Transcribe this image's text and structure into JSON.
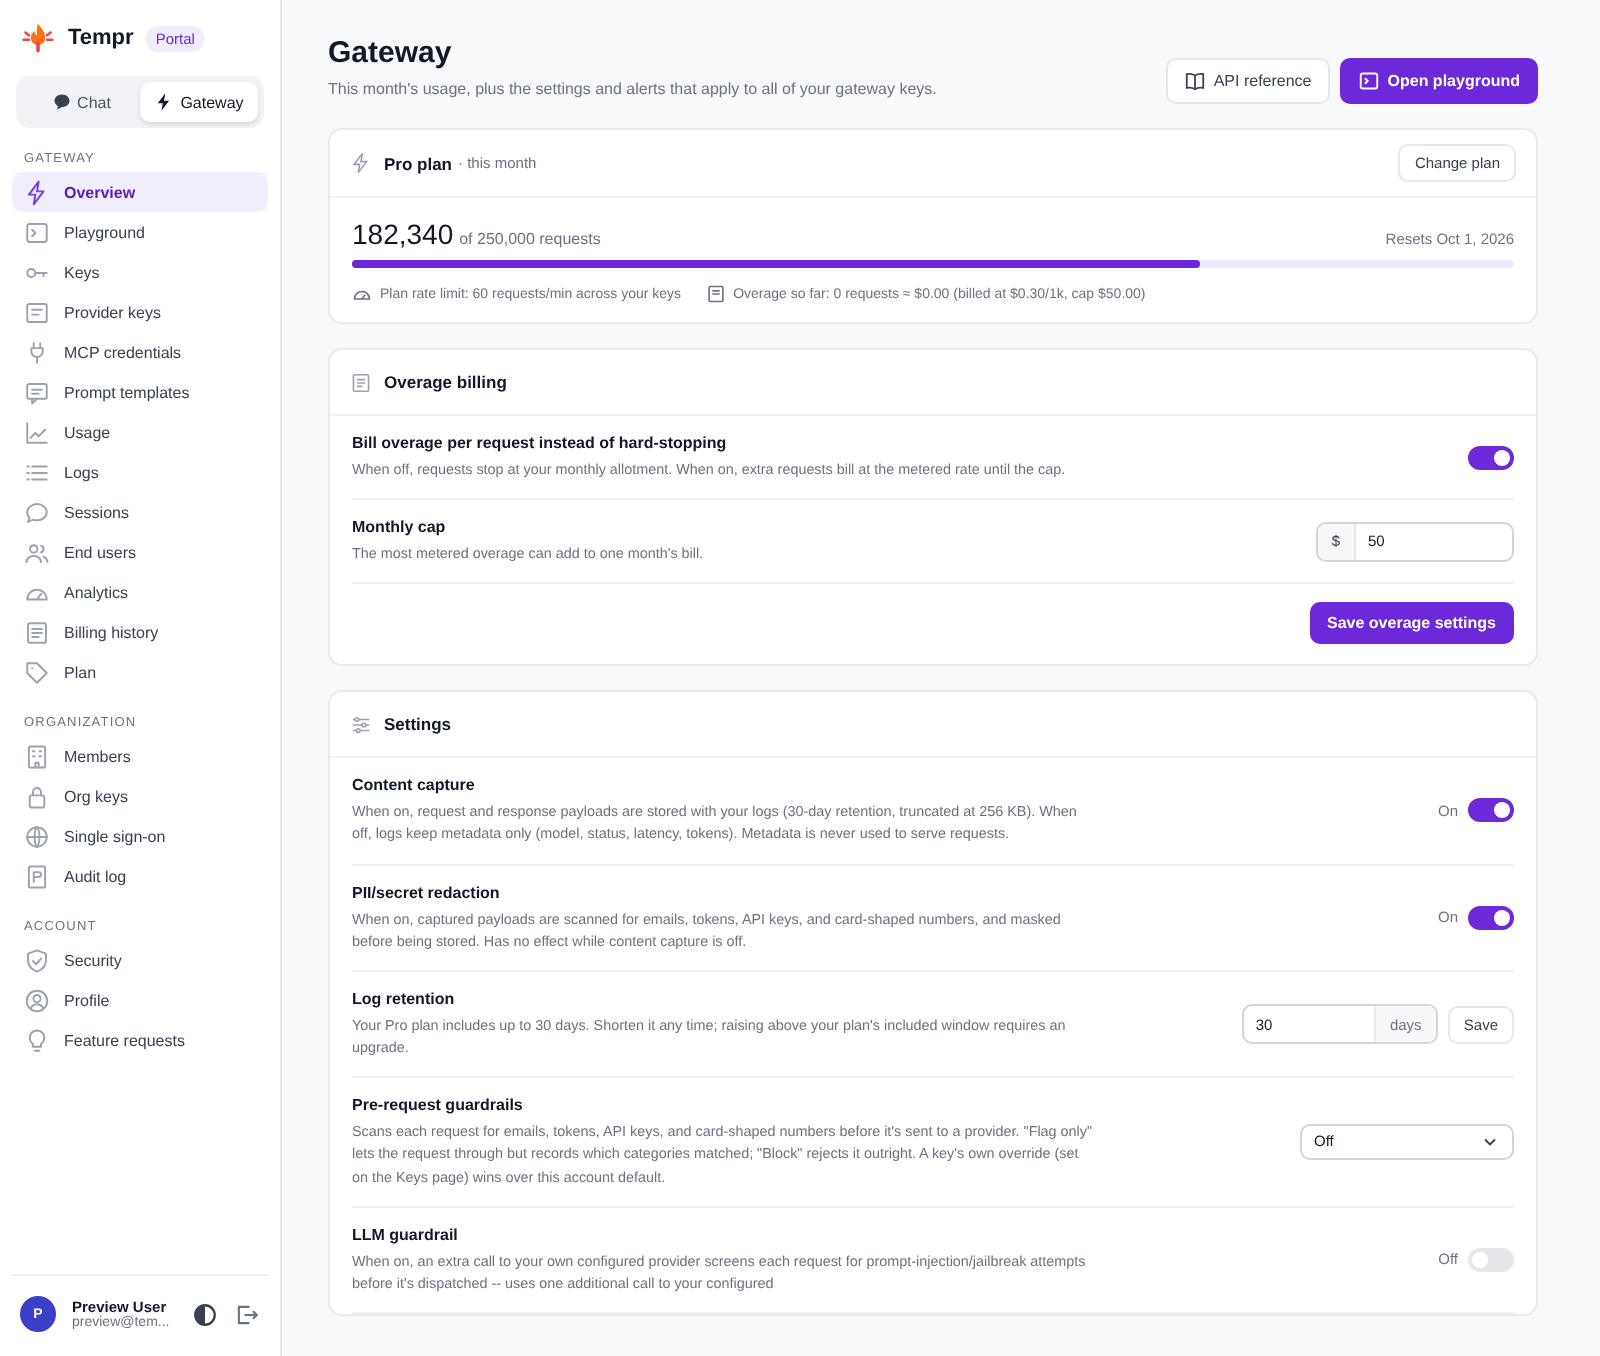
{
  "brand": {
    "name": "Tempr",
    "badge": "Portal"
  },
  "mode_tabs": [
    {
      "label": "Chat",
      "selected": false
    },
    {
      "label": "Gateway",
      "selected": true
    }
  ],
  "nav": [
    {
      "heading": "GATEWAY",
      "items": [
        {
          "label": "Overview",
          "selected": true
        },
        {
          "label": "Playground",
          "selected": false
        },
        {
          "label": "Keys",
          "selected": false
        },
        {
          "label": "Provider keys",
          "selected": false
        },
        {
          "label": "MCP credentials",
          "selected": false
        },
        {
          "label": "Prompt templates",
          "selected": false
        },
        {
          "label": "Usage",
          "selected": false
        },
        {
          "label": "Logs",
          "selected": false
        },
        {
          "label": "Sessions",
          "selected": false
        },
        {
          "label": "End users",
          "selected": false
        },
        {
          "label": "Analytics",
          "selected": false
        },
        {
          "label": "Billing history",
          "selected": false
        },
        {
          "label": "Plan",
          "selected": false
        }
      ]
    },
    {
      "heading": "ORGANIZATION",
      "items": [
        {
          "label": "Members",
          "selected": false
        },
        {
          "label": "Org keys",
          "selected": false
        },
        {
          "label": "Single sign-on",
          "selected": false
        },
        {
          "label": "Audit log",
          "selected": false
        }
      ]
    },
    {
      "heading": "ACCOUNT",
      "items": [
        {
          "label": "Security",
          "selected": false
        },
        {
          "label": "Profile",
          "selected": false
        },
        {
          "label": "Feature requests",
          "selected": false
        }
      ]
    }
  ],
  "user": {
    "initial": "P",
    "name": "Preview User",
    "email": "preview@tem..."
  },
  "page": {
    "title": "Gateway",
    "subtitle": "This month's usage, plus the settings and alerts that apply to all of your gateway keys.",
    "buttons": [
      {
        "label": "API reference",
        "kind": "secondary"
      },
      {
        "label": "Open playground",
        "kind": "primary"
      }
    ]
  },
  "plan": {
    "title": "Pro plan",
    "suffix": "· this month",
    "action": "Change plan",
    "used": "182,340",
    "of": "of 250,000 requests",
    "resets": "Resets Oct 1, 2026",
    "level": 0.729,
    "notes": [
      "Plan rate limit: 60 requests/min across your keys",
      "Overage so far: 0 requests ≈ $0.00 (billed at $0.30/1k, cap $50.00)"
    ]
  },
  "overage": {
    "title": "Overage billing",
    "rows": [
      {
        "kind": "toggle",
        "title": "Bill overage per request instead of hard-stopping",
        "description": "When off, requests stop at your monthly allotment. When on, extra requests bill at the metered rate until the cap.",
        "on": true
      },
      {
        "kind": "money",
        "title": "Monthly cap",
        "description": "The most metered overage can add to one month's bill.",
        "prefix": "$",
        "value": "50"
      }
    ],
    "save": "Save overage settings"
  },
  "settings": {
    "title": "Settings",
    "rows": [
      {
        "kind": "toggle",
        "title": "Content capture",
        "description": "When on, request and response payloads are stored with your logs (30-day retention, truncated at 256 KB). When off, logs keep metadata only (model, status, latency, tokens). Metadata is never used to serve requests.",
        "state_label": "On",
        "on": true
      },
      {
        "kind": "toggle",
        "title": "PII/secret redaction",
        "description": "When on, captured payloads are scanned for emails, tokens, API keys, and card-shaped numbers, and masked before being stored. Has no effect while content capture is off.",
        "state_label": "On",
        "on": true
      },
      {
        "kind": "number",
        "title": "Log retention",
        "description": "Your Pro plan includes up to 30 days. Shorten it any time; raising above your plan's included window requires an upgrade.",
        "value": "30",
        "unit": "days",
        "action": "Save"
      },
      {
        "kind": "select",
        "title": "Pre-request guardrails",
        "description": "Scans each request for emails, tokens, API keys, and card-shaped numbers before it's sent to a provider. \"Flag only\" lets the request through but records which categories matched; \"Block\" rejects it outright. A key's own override (set on the Keys page) wins over this account default.",
        "value": "Off"
      },
      {
        "kind": "toggle",
        "title": "LLM guardrail",
        "description": "When on, an extra call to your own configured provider screens each request for prompt-injection/jailbreak attempts before it's dispatched -- uses one additional call to your configured",
        "state_label": "Off",
        "on": false
      }
    ]
  }
}
